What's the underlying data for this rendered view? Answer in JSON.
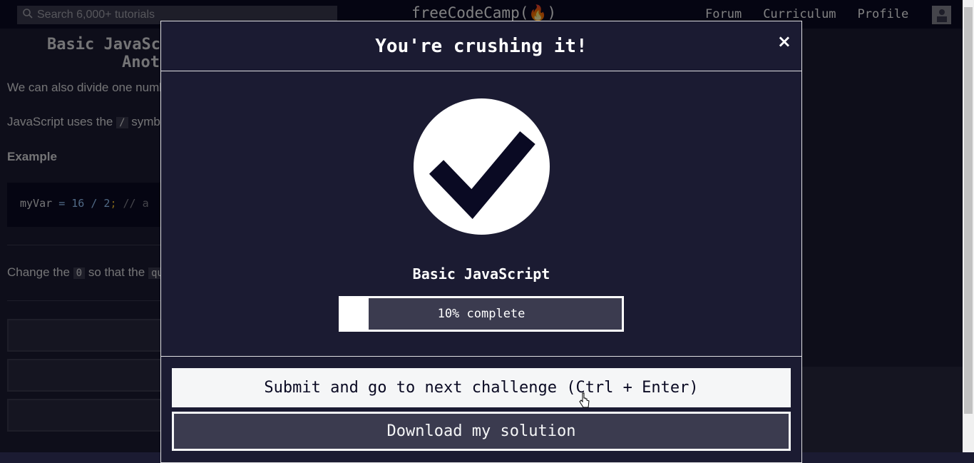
{
  "nav": {
    "search_placeholder": "Search 6,000+ tutorials",
    "logo": "freeCodeCamp(🔥)",
    "links": [
      "Forum",
      "Curriculum",
      "Profile"
    ]
  },
  "lesson": {
    "title_line1": "Basic JavaSc",
    "title_line2": "Anot",
    "para1": "We can also divide one numb",
    "para2_pre": "JavaScript uses the",
    "para2_code": "/",
    "para2_post": "symb",
    "example_heading": "Example",
    "code": {
      "var": "myVar",
      "eq": "=",
      "n1": "16",
      "op": "/",
      "n2": "2",
      "semi": ";",
      "comment": "// a"
    },
    "change_pre": "Change the",
    "change_code": "0",
    "change_mid": "so that the",
    "change_code2": "qu"
  },
  "modal": {
    "title": "You're crushing it!",
    "close": "×",
    "certification": "Basic JavaScript",
    "progress_percent": 10,
    "progress_text": "10% complete",
    "submit_label": "Submit and go to next challenge (Ctrl + Enter)",
    "download_label": "Download my solution"
  },
  "colors": {
    "background": "#1b1b32",
    "nav": "#0a0a23",
    "accent": "#f5f6f7"
  }
}
